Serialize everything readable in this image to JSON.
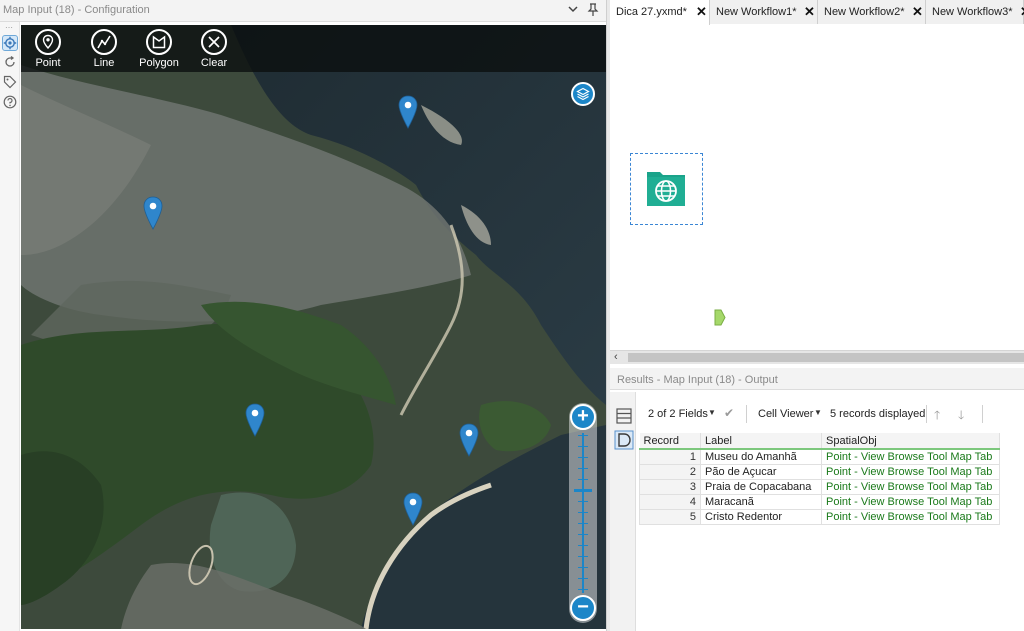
{
  "config_pane": {
    "title": "Map Input (18) - Configuration"
  },
  "map": {
    "tools": [
      {
        "label": "Point",
        "icon": "map-pin-icon"
      },
      {
        "label": "Line",
        "icon": "line-icon"
      },
      {
        "label": "Polygon",
        "icon": "polygon-icon"
      },
      {
        "label": "Clear",
        "icon": "close-icon"
      }
    ],
    "zoom_in": "+",
    "zoom_out": "−",
    "pin_count": 5
  },
  "workflow_tabs": [
    {
      "label": "Dica 27.yxmd*",
      "active": true
    },
    {
      "label": "New Workflow1*",
      "active": false
    },
    {
      "label": "New Workflow2*",
      "active": false
    },
    {
      "label": "New Workflow3*",
      "active": false
    }
  ],
  "results": {
    "title": "Results - Map Input (18) - Output",
    "fields_label": "2 of 2 Fields",
    "viewer_label": "Cell Viewer",
    "records_label": "5 records displayed",
    "columns": [
      "Record",
      "Label",
      "SpatialObj"
    ],
    "rows": [
      {
        "record": "1",
        "label": "Museu do Amanhã",
        "spatial": "Point - View Browse Tool Map Tab"
      },
      {
        "record": "2",
        "label": "Pão de Açucar",
        "spatial": "Point - View Browse Tool Map Tab"
      },
      {
        "record": "3",
        "label": "Praia de Copacabana",
        "spatial": "Point - View Browse Tool Map Tab"
      },
      {
        "record": "4",
        "label": "Maracanã",
        "spatial": "Point - View Browse Tool Map Tab"
      },
      {
        "record": "5",
        "label": "Cristo Redentor",
        "spatial": "Point - View Browse Tool Map Tab"
      }
    ]
  },
  "colors": {
    "accent_blue": "#1c86c8",
    "tool_teal": "#1aa38a",
    "anchor_green": "#a5d86a",
    "spatial_text": "#1a7a1a"
  }
}
